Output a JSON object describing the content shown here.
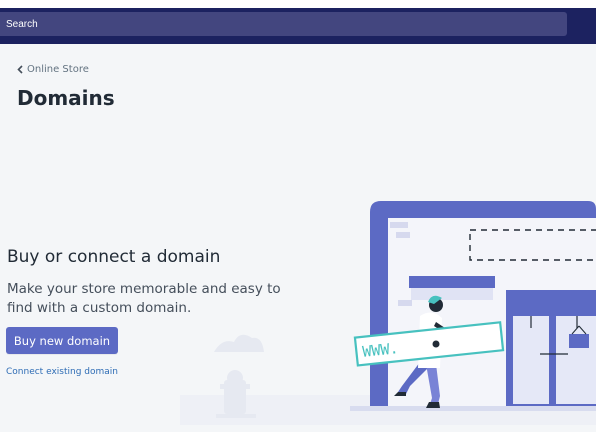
{
  "search": {
    "placeholder": "Search"
  },
  "breadcrumb": {
    "label": "Online Store"
  },
  "page": {
    "title": "Domains"
  },
  "hero": {
    "heading": "Buy or connect a domain",
    "description": "Make your store memorable and easy to find with a custom domain.",
    "primary_button": "Buy new domain",
    "secondary_link": "Connect existing domain"
  },
  "illustration": {
    "sign_text": "WWW.",
    "icons": [
      "storefront-illustration",
      "person-carrying-sign-illustration",
      "fire-hydrant-illustration",
      "cloud-illustration"
    ]
  },
  "colors": {
    "topbar": "#1c2260",
    "search_bg": "#43467f",
    "primary": "#5c6ac4",
    "link": "#2f6db5",
    "background": "#f4f6f8",
    "teal": "#47c1bf"
  }
}
